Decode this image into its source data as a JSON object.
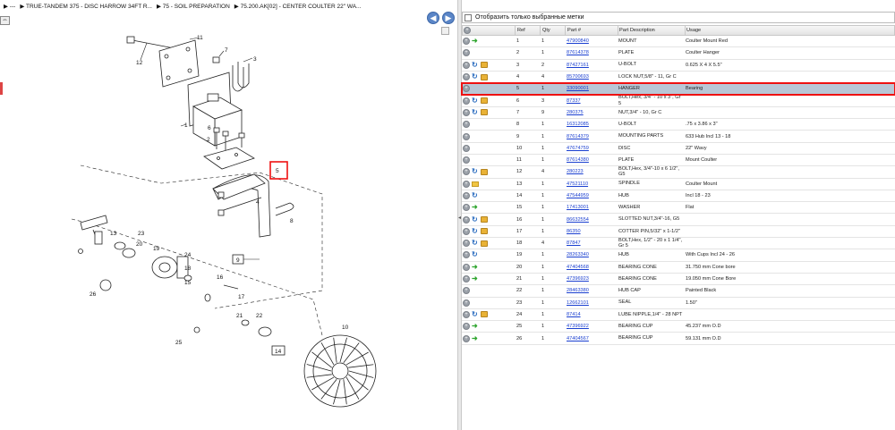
{
  "breadcrumb": {
    "items": [
      "▶ ---",
      "▶ TRUE-TANDEM 375 - DISC HARROW 34FT R...",
      "▶ 75 - SOIL PREPARATION",
      "▶ 75.200.AK[02] - CENTER COULTER 22\" WA..."
    ]
  },
  "nav": {
    "back_icon": "back-arrow-icon",
    "forward_icon": "forward-arrow-icon"
  },
  "filter": {
    "label": "Отобразить только выбранные метки"
  },
  "columns": {
    "ref": "Ref",
    "qty": "Qty",
    "part": "Part #",
    "desc": "Part Description",
    "usage": "Usage"
  },
  "rows": [
    {
      "icons": [
        "plus",
        "arrow"
      ],
      "ref": "1",
      "qty": "1",
      "part": "47900840",
      "desc": "MOUNT",
      "usage": "Coulter Mount Red"
    },
    {
      "icons": [
        "plus"
      ],
      "ref": "2",
      "qty": "1",
      "part": "87614378",
      "desc": "PLATE",
      "usage": "Coulter Hanger"
    },
    {
      "icons": [
        "plus",
        "swap",
        "box"
      ],
      "ref": "3",
      "qty": "2",
      "part": "87427161",
      "desc": "U-BOLT",
      "usage": "0.625 X 4 X 5.5\""
    },
    {
      "icons": [
        "plus",
        "swap",
        "box"
      ],
      "ref": "4",
      "qty": "4",
      "part": "85700693",
      "desc": "LOCK NUT,5/8\" - 11, Gr C",
      "usage": ""
    },
    {
      "icons": [
        "plus"
      ],
      "ref": "5",
      "qty": "1",
      "part": "33090001",
      "desc": "HANGER",
      "usage": "Bearing",
      "selected": true
    },
    {
      "icons": [
        "plus",
        "swap",
        "box"
      ],
      "ref": "6",
      "qty": "3",
      "part": "87337",
      "desc": "BOLT,Hex, 3/4\" - 10 x 3\", Gr 5",
      "usage": ""
    },
    {
      "icons": [
        "plus",
        "swap",
        "box"
      ],
      "ref": "7",
      "qty": "9",
      "part": "280375",
      "desc": "NUT,3/4\" - 10, Gr C",
      "usage": ""
    },
    {
      "icons": [
        "plus"
      ],
      "ref": "8",
      "qty": "1",
      "part": "16312085",
      "desc": "U-BOLT",
      "usage": ".75 x 3.86 x 3\""
    },
    {
      "icons": [
        "plus"
      ],
      "ref": "9",
      "qty": "1",
      "part": "87614379",
      "desc": "MOUNTING PARTS",
      "usage": "633 Hub Incl 13 - 18"
    },
    {
      "icons": [
        "plus"
      ],
      "ref": "10",
      "qty": "1",
      "part": "47674759",
      "desc": "DISC",
      "usage": "22\" Wavy"
    },
    {
      "icons": [
        "plus"
      ],
      "ref": "11",
      "qty": "1",
      "part": "87614380",
      "desc": "PLATE",
      "usage": "Mount Coulter"
    },
    {
      "icons": [
        "plus",
        "swap",
        "box"
      ],
      "ref": "12",
      "qty": "4",
      "part": "280223",
      "desc": "BOLT,Hex, 3/4\"-10 x 6 1/2\", G5",
      "usage": ""
    },
    {
      "icons": [
        "plus",
        "fold"
      ],
      "ref": "13",
      "qty": "1",
      "part": "47521110",
      "desc": "SPINDLE",
      "usage": "Coulter Mount"
    },
    {
      "icons": [
        "plus",
        "swap"
      ],
      "ref": "14",
      "qty": "1",
      "part": "47544959",
      "desc": "HUB",
      "usage": "Incl 18 - 23"
    },
    {
      "icons": [
        "plus",
        "arrow"
      ],
      "ref": "15",
      "qty": "1",
      "part": "17413001",
      "desc": "WASHER",
      "usage": "Flat"
    },
    {
      "icons": [
        "plus",
        "swap",
        "box"
      ],
      "ref": "16",
      "qty": "1",
      "part": "86632554",
      "desc": "SLOTTED NUT,3/4\"-16, G5",
      "usage": ""
    },
    {
      "icons": [
        "plus",
        "swap",
        "box"
      ],
      "ref": "17",
      "qty": "1",
      "part": "86350",
      "desc": "COTTER PIN,5/32\" x 1-1/2\"",
      "usage": ""
    },
    {
      "icons": [
        "plus",
        "swap",
        "box"
      ],
      "ref": "18",
      "qty": "4",
      "part": "87847",
      "desc": "BOLT,Hex, 1/2\" - 20 x 1 1/4\", Gr 5",
      "usage": ""
    },
    {
      "icons": [
        "plus",
        "swap"
      ],
      "ref": "19",
      "qty": "1",
      "part": "28263340",
      "desc": "HUB",
      "usage": "With Cups  Incl 24 - 26"
    },
    {
      "icons": [
        "plus",
        "arrow"
      ],
      "ref": "20",
      "qty": "1",
      "part": "47404568",
      "desc": "BEARING CONE",
      "usage": "31.750 mm Cone bore"
    },
    {
      "icons": [
        "plus",
        "arrow"
      ],
      "ref": "21",
      "qty": "1",
      "part": "47396923",
      "desc": "BEARING CONE",
      "usage": "19.050 mm Cone Bore"
    },
    {
      "icons": [
        "plus"
      ],
      "ref": "22",
      "qty": "1",
      "part": "28463380",
      "desc": "HUB CAP",
      "usage": "Painted Black"
    },
    {
      "icons": [
        "plus"
      ],
      "ref": "23",
      "qty": "1",
      "part": "12662101",
      "desc": "SEAL",
      "usage": "1.50\""
    },
    {
      "icons": [
        "plus",
        "swap",
        "box"
      ],
      "ref": "24",
      "qty": "1",
      "part": "87414",
      "desc": "LUBE NIPPLE,1/4\" - 28 NPT",
      "usage": ""
    },
    {
      "icons": [
        "plus",
        "arrow"
      ],
      "ref": "25",
      "qty": "1",
      "part": "47396922",
      "desc": "BEARING CUP",
      "usage": "45.237 mm O.D"
    },
    {
      "icons": [
        "plus",
        "arrow"
      ],
      "ref": "26",
      "qty": "1",
      "part": "47404567",
      "desc": "BEARING CUP",
      "usage": "59.131 mm O.D"
    }
  ],
  "diagram_labels": [
    "1",
    "2",
    "3",
    "4",
    "5",
    "6",
    "7",
    "8",
    "9",
    "10",
    "11",
    "12",
    "13",
    "14",
    "15",
    "16",
    "17",
    "18",
    "19",
    "20",
    "21",
    "22",
    "23",
    "24",
    "25",
    "26"
  ],
  "colors": {
    "selected_row": "#b9c7d6",
    "highlight": "#e11111",
    "link": "#1a3fd0",
    "nav_button": "#5b86c7"
  }
}
